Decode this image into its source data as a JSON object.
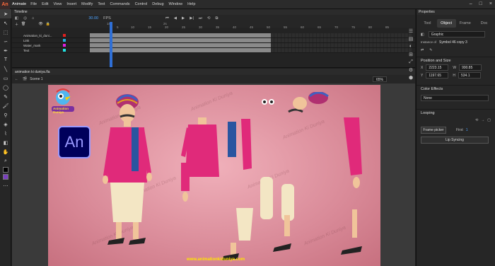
{
  "app": {
    "logo": "An",
    "name": "Animate",
    "menu": [
      "File",
      "Edit",
      "View",
      "Insert",
      "Modify",
      "Text",
      "Commands",
      "Control",
      "Debug",
      "Window",
      "Help"
    ]
  },
  "timeline": {
    "title": "Timeline",
    "fps": "30.00",
    "fps_unit": "FPS",
    "ruler": [
      "1s",
      "2s",
      "5",
      "10",
      "15",
      "20",
      "25",
      "30",
      "35",
      "40",
      "45",
      "50",
      "55",
      "60",
      "65",
      "70",
      "75",
      "80",
      "85"
    ],
    "layers": [
      {
        "name": "Animation_ki_duni...",
        "color": "#e02020"
      },
      {
        "name": "Link",
        "color": "#20b0e0"
      },
      {
        "name": "Water_mark",
        "color": "#e020e0"
      },
      {
        "name": "Text",
        "color": "#20e0e0"
      }
    ]
  },
  "document": {
    "tab": "animation ki duniya.fla",
    "scene": "Scene 1",
    "zoom": "65%"
  },
  "stage": {
    "logo_text": "Animation Duniya",
    "an_badge": "An",
    "watermark": "Animation Ki Duniya",
    "website": "www.animationkiduniya.com"
  },
  "properties": {
    "title": "Properties",
    "tabs": [
      "Tool",
      "Object",
      "Frame",
      "Doc"
    ],
    "active_tab": "Object",
    "symbol_type": "Graphic",
    "instance_label": "Instance of",
    "instance_name": "Symbol 46 copy 3",
    "position_section": "Position and Size",
    "x": "2223.15",
    "y": "1197.65",
    "w": "990.85",
    "h": "534.1",
    "color_section": "Color Effects",
    "color_value": "None",
    "looping_section": "Looping",
    "frame_picker": "Frame picker",
    "first_label": "First",
    "first_value": "1",
    "lip_sync": "Lip Syncing"
  }
}
